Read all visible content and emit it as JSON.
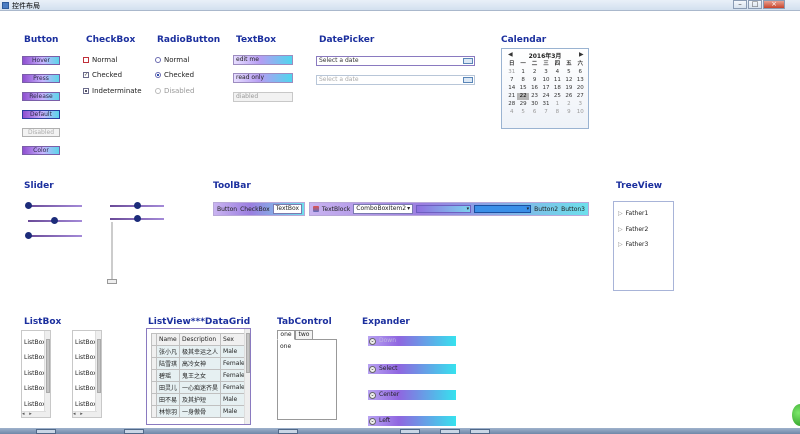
{
  "window": {
    "title": "控件布局"
  },
  "sections": {
    "button": "Button",
    "checkbox": "CheckBox",
    "radiobutton": "RadioButton",
    "textbox": "TextBox",
    "datepicker": "DatePicker",
    "calendar": "Calendar",
    "slider": "Slider",
    "toolbar": "ToolBar",
    "treeview": "TreeView",
    "listbox": "ListBox",
    "listview": "ListView***DataGrid",
    "tabcontrol": "TabControl",
    "expander": "Expander"
  },
  "buttons": {
    "hover": "Hover",
    "press": "Press",
    "release": "Release",
    "default": "Default",
    "disabled": "Disabled",
    "color": "Color"
  },
  "checkboxes": {
    "normal": "Normal",
    "checked": "Checked",
    "indeterminate": "Indeterminate"
  },
  "radios": {
    "normal": "Normal",
    "checked": "Checked",
    "disabled": "Disabled"
  },
  "textboxes": {
    "edit": "edit me",
    "readonly": "read only",
    "disabled": "diabled"
  },
  "datepicker": {
    "placeholder1": "Select a date",
    "placeholder2": "Select a date"
  },
  "calendar": {
    "header": "2016年3月",
    "weekdays": [
      "日",
      "一",
      "二",
      "三",
      "四",
      "五",
      "六"
    ],
    "days": [
      "31",
      "1",
      "2",
      "3",
      "4",
      "5",
      "6",
      "7",
      "8",
      "9",
      "10",
      "11",
      "12",
      "13",
      "14",
      "15",
      "16",
      "17",
      "18",
      "19",
      "20",
      "21",
      "22",
      "23",
      "24",
      "25",
      "26",
      "27",
      "28",
      "29",
      "30",
      "31",
      "1",
      "2",
      "3",
      "4",
      "5",
      "6",
      "7",
      "8",
      "9",
      "10"
    ],
    "today": "22"
  },
  "toolbar": {
    "left": {
      "button": "Button",
      "checkbox": "CheckBox",
      "textbox": "TextBox"
    },
    "right": {
      "textblock": "TextBlock",
      "combo": "ComboBoxItem2",
      "button2": "Button2",
      "button3": "Button3"
    }
  },
  "treeview": {
    "items": [
      "Father1",
      "Father2",
      "Father3"
    ]
  },
  "listbox": {
    "items": [
      "ListBox",
      "ListBox",
      "ListBox",
      "ListBox",
      "ListBox"
    ]
  },
  "datagrid": {
    "columns": [
      "Name",
      "Description",
      "Sex"
    ],
    "rows": [
      [
        "张小凡",
        "极其幸运之人",
        "Male"
      ],
      [
        "陆雪琪",
        "高冷女神",
        "Female"
      ],
      [
        "碧瑶",
        "鬼王之女",
        "Female"
      ],
      [
        "田灵儿",
        "一心痴迷齐昊",
        "Female"
      ],
      [
        "田不易",
        "及其护短",
        "Male"
      ],
      [
        "林惊羽",
        "一身傲骨",
        "Male"
      ]
    ]
  },
  "tabcontrol": {
    "tabs": [
      "one",
      "two"
    ],
    "content": "one"
  },
  "expanders": {
    "down": "Down",
    "select": "Select",
    "center": "Center",
    "left": "Left"
  }
}
